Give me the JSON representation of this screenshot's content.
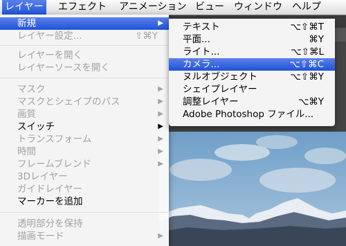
{
  "menubar": {
    "items": [
      {
        "label": "レイヤー"
      },
      {
        "label": "エフェクト"
      },
      {
        "label": "アニメーション"
      },
      {
        "label": "ビュー"
      },
      {
        "label": "ウィンドウ"
      },
      {
        "label": "ヘルプ"
      }
    ]
  },
  "layer_menu": {
    "items": [
      {
        "label": "新規",
        "state": "highlighted",
        "submenu": true
      },
      {
        "label": "レイヤー設定...",
        "shortcut": "⇧⌘Y",
        "state": "disabled"
      },
      {
        "label": "レイヤーを開く",
        "state": "disabled"
      },
      {
        "label": "レイヤーソースを開く",
        "state": "disabled"
      },
      {
        "label": "マスク",
        "state": "disabled",
        "submenu": true
      },
      {
        "label": "マスクとシェイプのパス",
        "state": "disabled",
        "submenu": true
      },
      {
        "label": "画質",
        "state": "disabled",
        "submenu": true
      },
      {
        "label": "スイッチ",
        "state": "enabled",
        "submenu": true
      },
      {
        "label": "トランスフォーム",
        "state": "disabled",
        "submenu": true
      },
      {
        "label": "時間",
        "state": "disabled",
        "submenu": true
      },
      {
        "label": "フレームブレンド",
        "state": "disabled",
        "submenu": true
      },
      {
        "label": "3Dレイヤー",
        "state": "disabled"
      },
      {
        "label": "ガイドレイヤー",
        "state": "disabled"
      },
      {
        "label": "マーカーを追加",
        "state": "enabled"
      },
      {
        "label": "透明部分を保持",
        "state": "disabled"
      },
      {
        "label": "描画モード",
        "state": "disabled",
        "submenu": true
      }
    ]
  },
  "new_submenu": {
    "items": [
      {
        "label": "テキスト",
        "shortcut": "⌥⇧⌘T"
      },
      {
        "label": "平面...",
        "shortcut": "⌘Y"
      },
      {
        "label": "ライト...",
        "shortcut": "⌥⇧⌘L"
      },
      {
        "label": "カメラ...",
        "shortcut": "⌥⇧⌘C",
        "highlighted": true
      },
      {
        "label": "ヌルオブジェクト",
        "shortcut": "⌥⇧⌘Y"
      },
      {
        "label": "シェイプレイヤー",
        "shortcut": ""
      },
      {
        "label": "調整レイヤー",
        "shortcut": "⌥⌘Y"
      },
      {
        "label": "Adobe Photoshop ファイル...",
        "shortcut": ""
      }
    ]
  },
  "icons": {
    "submenu_arrow": "▶"
  },
  "colors": {
    "highlight": "#2155d8",
    "disabled_text": "#a2a2a2"
  }
}
